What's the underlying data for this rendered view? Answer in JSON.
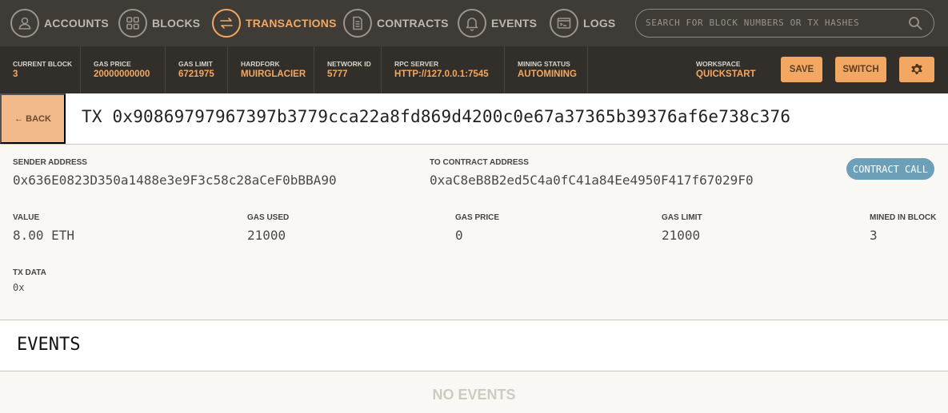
{
  "nav": {
    "items": [
      {
        "label": "ACCOUNTS",
        "icon": "user-icon"
      },
      {
        "label": "BLOCKS",
        "icon": "grid-icon"
      },
      {
        "label": "TRANSACTIONS",
        "icon": "swap-arrows-icon"
      },
      {
        "label": "CONTRACTS",
        "icon": "document-icon"
      },
      {
        "label": "EVENTS",
        "icon": "bell-icon"
      },
      {
        "label": "LOGS",
        "icon": "terminal-icon"
      }
    ],
    "active": "TRANSACTIONS",
    "search_placeholder": "SEARCH FOR BLOCK NUMBERS OR TX HASHES"
  },
  "status": {
    "current_block": {
      "label": "CURRENT BLOCK",
      "value": "3"
    },
    "gas_price": {
      "label": "GAS PRICE",
      "value": "20000000000"
    },
    "gas_limit": {
      "label": "GAS LIMIT",
      "value": "6721975"
    },
    "hardfork": {
      "label": "HARDFORK",
      "value": "MUIRGLACIER"
    },
    "network_id": {
      "label": "NETWORK ID",
      "value": "5777"
    },
    "rpc_server": {
      "label": "RPC SERVER",
      "value": "HTTP://127.0.0.1:7545"
    },
    "mining_status": {
      "label": "MINING STATUS",
      "value": "AUTOMINING"
    },
    "workspace": {
      "label": "WORKSPACE",
      "value": "QUICKSTART"
    },
    "save_label": "SAVE",
    "switch_label": "SWITCH"
  },
  "tx": {
    "back_label": "← BACK",
    "title": "TX 0x90869797967397b3779cca22a8fd869d4200c0e67a37365b39376af6e738c376",
    "sender": {
      "label": "SENDER ADDRESS",
      "value": "0x636E0823D350a1488e3e9F3c58c28aCeF0bBBA90"
    },
    "to_contract": {
      "label": "TO CONTRACT ADDRESS",
      "value": "0xaC8eB8B2ed5C4a0fC41a84Ee4950F417f67029F0"
    },
    "badge": "CONTRACT CALL",
    "value": {
      "label": "VALUE",
      "value": "8.00 ETH"
    },
    "gas_used": {
      "label": "GAS USED",
      "value": "21000"
    },
    "gas_price": {
      "label": "GAS PRICE",
      "value": "0"
    },
    "gas_limit": {
      "label": "GAS LIMIT",
      "value": "21000"
    },
    "mined_in_block": {
      "label": "MINED IN BLOCK",
      "value": "3"
    },
    "tx_data": {
      "label": "TX DATA",
      "value": "0x"
    }
  },
  "events": {
    "title": "EVENTS",
    "empty": "NO EVENTS"
  },
  "colors": {
    "accent": "#f2a863",
    "nav_bg": "#3f3b36",
    "status_bg": "#322f2b",
    "badge": "#6ba0b8"
  }
}
